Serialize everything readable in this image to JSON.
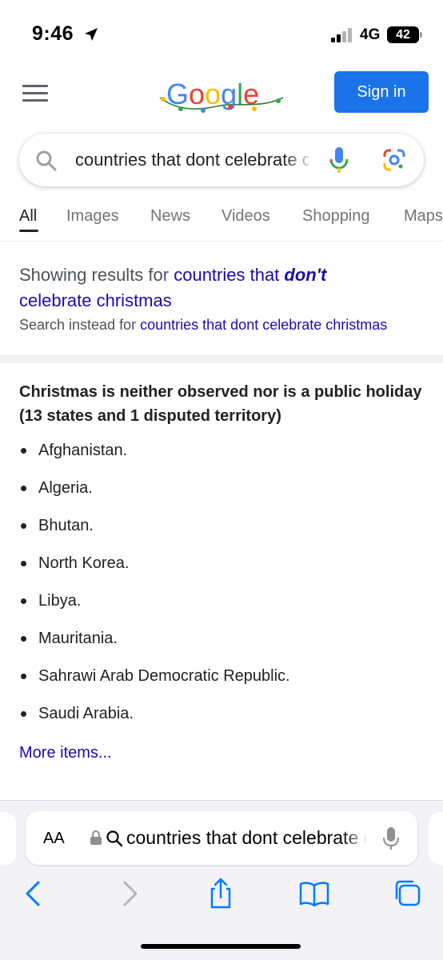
{
  "status_bar": {
    "time": "9:46",
    "network": "4G",
    "battery": "42"
  },
  "header": {
    "logo_alt": "Google",
    "sign_in_label": "Sign in",
    "menu_icon": "hamburger-menu-icon"
  },
  "search": {
    "query": "countries that dont celebrate christmas",
    "icons": [
      "search-icon",
      "mic-icon",
      "google-lens-icon"
    ]
  },
  "tabs": [
    {
      "label": "All",
      "active": true
    },
    {
      "label": "Images"
    },
    {
      "label": "News"
    },
    {
      "label": "Videos"
    },
    {
      "label": "Shopping"
    },
    {
      "label": "Maps"
    }
  ],
  "spelling": {
    "showing_prefix": "Showing results for",
    "corrected_part1": "countries that",
    "corrected_emph": "don't",
    "corrected_part2": "celebrate christmas",
    "instead_prefix": "Search instead for",
    "instead_query": "countries that dont celebrate christmas"
  },
  "featured": {
    "title": "Christmas is neither observed nor is a public holiday (13 states and 1 disputed territory)",
    "items": [
      "Afghanistan.",
      "Algeria.",
      "Bhutan.",
      "North Korea.",
      "Libya.",
      "Mauritania.",
      "Sahrawi Arab Democratic Republic.",
      "Saudi Arabia."
    ],
    "more_label": "More items..."
  },
  "safari": {
    "text_size_label": "AA",
    "url_text": "countries that dont celebrate christmas",
    "toolbar_icons": [
      "back-icon",
      "forward-icon",
      "share-icon",
      "bookmarks-icon",
      "tabs-icon"
    ]
  },
  "colors": {
    "link": "#1a0dab",
    "accent": "#1a73e8",
    "text": "#202124",
    "muted": "#70757a"
  }
}
